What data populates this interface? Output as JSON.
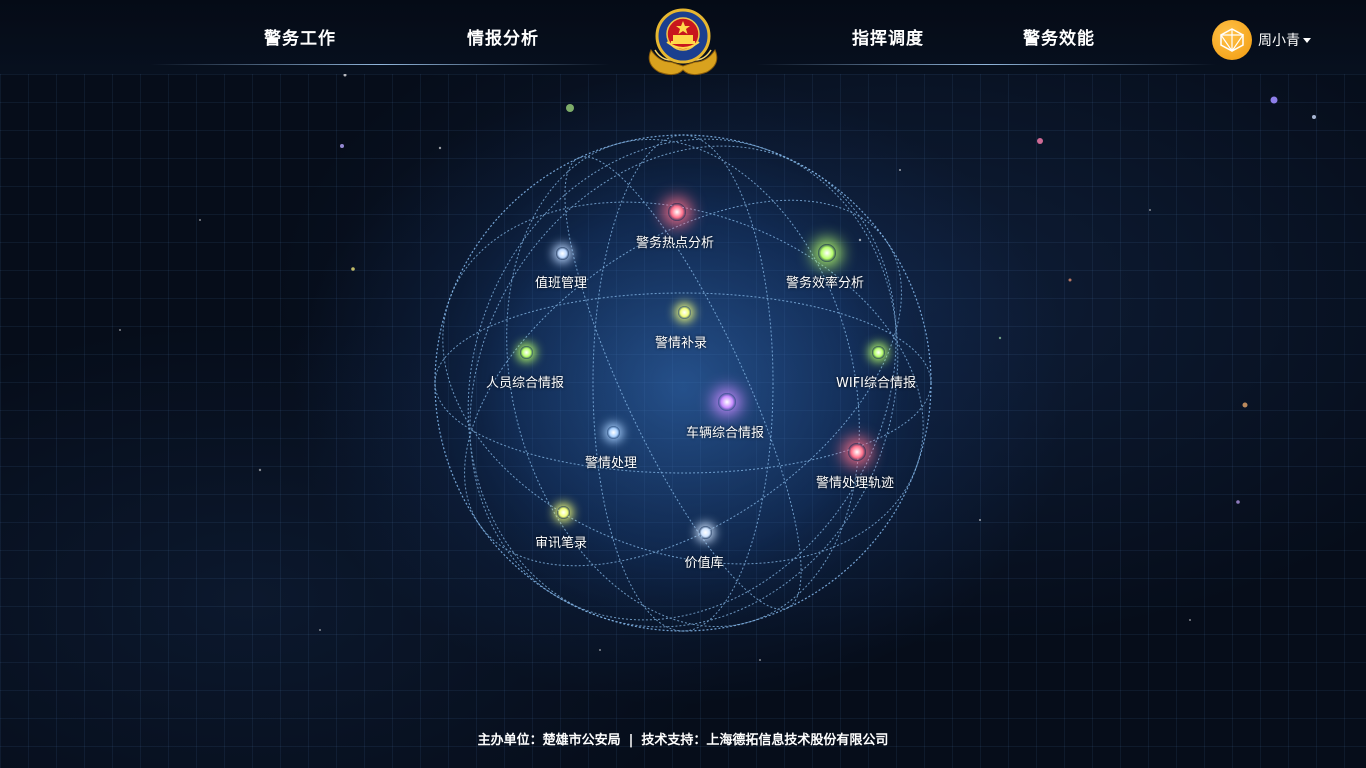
{
  "header": {
    "nav_left": [
      "警务工作",
      "情报分析"
    ],
    "nav_right": [
      "指挥调度",
      "警务效能"
    ],
    "user_name": "周小青"
  },
  "nodes": [
    {
      "label": "警务热点分析",
      "color": "#ff6f8a"
    },
    {
      "label": "值班管理",
      "color": "#bcd8ff"
    },
    {
      "label": "警务效率分析",
      "color": "#b7ff6a"
    },
    {
      "label": "警情补录",
      "color": "#f3ff7a"
    },
    {
      "label": "人员综合情报",
      "color": "#b7ff6a"
    },
    {
      "label": "WIFI综合情报",
      "color": "#b7ff6a"
    },
    {
      "label": "车辆综合情报",
      "color": "#c88bff"
    },
    {
      "label": "警情处理",
      "color": "#a9d1ff"
    },
    {
      "label": "警情处理轨迹",
      "color": "#ff6f8a"
    },
    {
      "label": "审讯笔录",
      "color": "#f3ff7a"
    },
    {
      "label": "价值库",
      "color": "#cfe4ff"
    }
  ],
  "footer": {
    "host": "主办单位：楚雄市公安局",
    "separator": "|",
    "support": "技术支持：上海德拓信息技术股份有限公司"
  }
}
